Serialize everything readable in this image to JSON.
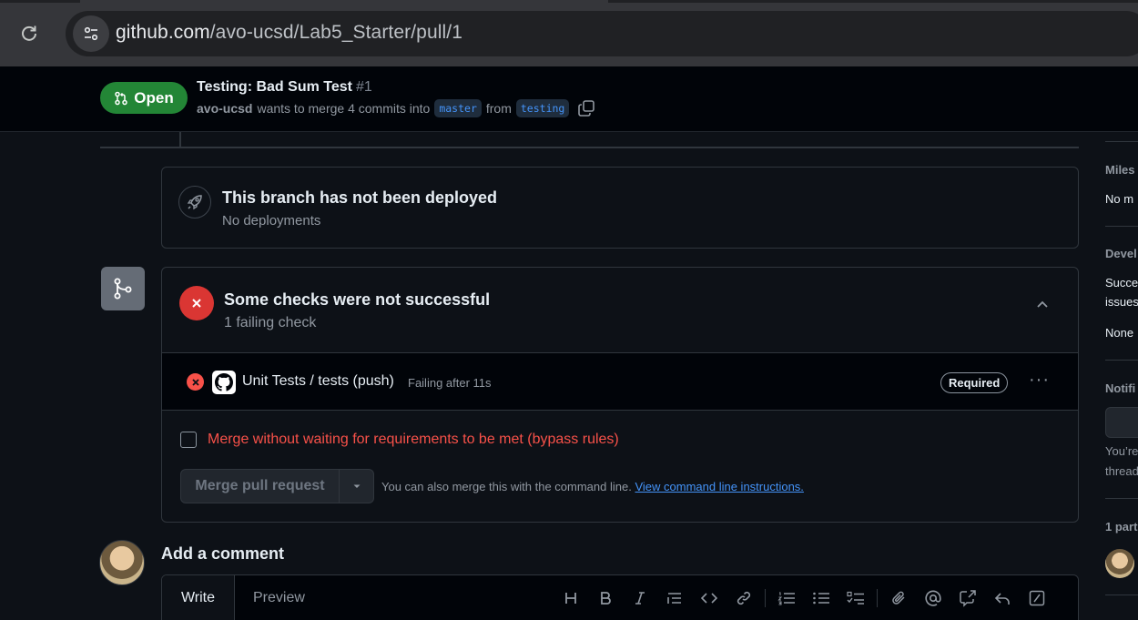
{
  "browser": {
    "url_host": "github.com",
    "url_path": "/avo-ucsd/Lab5_Starter/pull/1"
  },
  "pr": {
    "state": "Open",
    "title": "Testing: Bad Sum Test",
    "number": "#1",
    "author": "avo-ucsd",
    "merge_text": "wants to merge 4 commits into",
    "base_branch": "master",
    "from_text": "from",
    "head_branch": "testing"
  },
  "deploy": {
    "title": "This branch has not been deployed",
    "subtitle": "No deployments"
  },
  "checks": {
    "title": "Some checks were not successful",
    "subtitle": "1 failing check",
    "items": [
      {
        "name": "Unit Tests / tests (push)",
        "status": "Failing after 11s",
        "badge": "Required"
      }
    ],
    "bypass_label": "Merge without waiting for requirements to be met (bypass rules)",
    "merge_button": "Merge pull request",
    "cli_note": "You can also merge this with the command line.",
    "cli_link": "View command line instructions."
  },
  "comment": {
    "heading": "Add a comment",
    "tab_write": "Write",
    "tab_preview": "Preview",
    "toolbar": [
      "heading-icon",
      "bold-icon",
      "italic-icon",
      "quote-icon",
      "code-icon",
      "link-icon",
      "ordered-list-icon",
      "unordered-list-icon",
      "task-list-icon",
      "attach-icon",
      "mention-icon",
      "reference-icon",
      "reply-icon",
      "slash-command-icon"
    ]
  },
  "sidebar": {
    "milestone_heading": "Miles",
    "milestone_value": "No m",
    "development_heading": "Devel",
    "development_line1": "Succe",
    "development_line2": "issues",
    "development_value": "None",
    "notifications_heading": "Notifi",
    "notifications_line1": "You’re",
    "notifications_line2": "thread",
    "participants_heading": "1 part"
  },
  "colors": {
    "open_green": "#238636",
    "fail_red": "#da3633",
    "link_blue": "#4493f8"
  }
}
